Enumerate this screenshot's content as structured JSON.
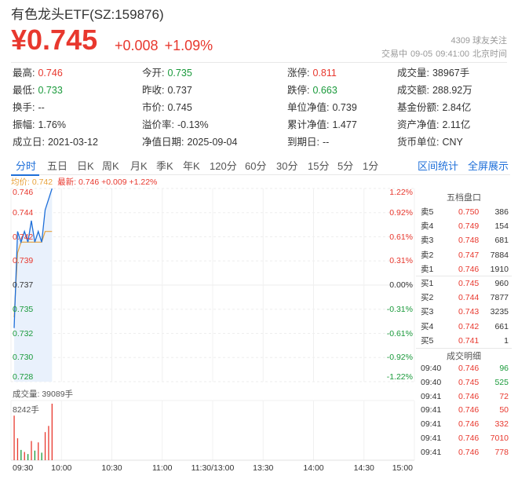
{
  "header": {
    "title": "有色龙头ETF(SZ:159876)",
    "price": "¥0.745",
    "change": "+0.008",
    "change_pct": "+1.09%",
    "followers": "4309 球友关注",
    "status": "交易中",
    "date": "09-05",
    "time": "09:41:00",
    "timezone": "北京时间"
  },
  "stats": [
    {
      "k": "最高:",
      "v": "0.746",
      "color": "red"
    },
    {
      "k": "今开:",
      "v": "0.735",
      "color": "green"
    },
    {
      "k": "涨停:",
      "v": "0.811",
      "color": "red"
    },
    {
      "k": "成交量:",
      "v": "38967手",
      "color": ""
    },
    {
      "k": "最低:",
      "v": "0.733",
      "color": "green"
    },
    {
      "k": "昨收:",
      "v": "0.737",
      "color": ""
    },
    {
      "k": "跌停:",
      "v": "0.663",
      "color": "green"
    },
    {
      "k": "成交额:",
      "v": "288.92万",
      "color": ""
    },
    {
      "k": "换手:",
      "v": "--",
      "color": ""
    },
    {
      "k": "市价:",
      "v": "0.745",
      "color": ""
    },
    {
      "k": "单位净值:",
      "v": "0.739",
      "color": ""
    },
    {
      "k": "基金份额:",
      "v": "2.84亿",
      "color": ""
    },
    {
      "k": "振幅:",
      "v": "1.76%",
      "color": ""
    },
    {
      "k": "溢价率:",
      "v": "-0.13%",
      "color": ""
    },
    {
      "k": "累计净值:",
      "v": "1.477",
      "color": ""
    },
    {
      "k": "资产净值:",
      "v": "2.11亿",
      "color": ""
    },
    {
      "k": "成立日:",
      "v": "2021-03-12",
      "color": ""
    },
    {
      "k": "净值日期:",
      "v": "2025-09-04",
      "color": ""
    },
    {
      "k": "到期日:",
      "v": "--",
      "color": ""
    },
    {
      "k": "货币单位:",
      "v": "CNY",
      "color": ""
    }
  ],
  "tabs": [
    "分时",
    "五日",
    "日K",
    "周K",
    "月K",
    "季K",
    "年K",
    "120分",
    "60分",
    "30分",
    "15分",
    "5分",
    "1分"
  ],
  "tab_active": "分时",
  "tab_links": [
    "区间统计",
    "全屏展示"
  ],
  "legend": {
    "avg": "均价: 0.742",
    "last": "最新: 0.746 +0.009 +1.22%"
  },
  "price_axis": [
    "0.746",
    "0.744",
    "0.742",
    "0.739",
    "0.737",
    "0.735",
    "0.732",
    "0.730",
    "0.728"
  ],
  "pct_axis": [
    "1.22%",
    "0.92%",
    "0.61%",
    "0.31%",
    "0.00%",
    "-0.31%",
    "-0.61%",
    "-0.92%",
    "-1.22%"
  ],
  "time_axis": [
    "09:30",
    "10:00",
    "10:30",
    "11:00",
    "11:30/13:00",
    "13:30",
    "14:00",
    "14:30",
    "15:00"
  ],
  "volume": {
    "label": "成交量: 39089手",
    "max": "8242手"
  },
  "chart_data": {
    "type": "line",
    "x": [
      "09:30",
      "09:31",
      "09:32",
      "09:33",
      "09:34",
      "09:35",
      "09:36",
      "09:37",
      "09:38",
      "09:39",
      "09:40",
      "09:41"
    ],
    "series": [
      {
        "name": "最新",
        "values": [
          0.733,
          0.742,
          0.741,
          0.742,
          0.741,
          0.743,
          0.741,
          0.742,
          0.741,
          0.744,
          0.745,
          0.746
        ]
      },
      {
        "name": "均价",
        "values": [
          0.734,
          0.74,
          0.741,
          0.741,
          0.741,
          0.741,
          0.741,
          0.741,
          0.741,
          0.742,
          0.742,
          0.742
        ]
      }
    ],
    "volume": [
      6500,
      3200,
      1500,
      1200,
      900,
      2800,
      1400,
      2600,
      1100,
      4100,
      5000,
      8242
    ],
    "ylim": [
      0.728,
      0.746
    ],
    "prev_close": 0.737
  },
  "orderbook": {
    "title": "五档盘口",
    "rows": [
      {
        "l": "卖5",
        "p": "0.750",
        "q": "386"
      },
      {
        "l": "卖4",
        "p": "0.749",
        "q": "154"
      },
      {
        "l": "卖3",
        "p": "0.748",
        "q": "681"
      },
      {
        "l": "卖2",
        "p": "0.747",
        "q": "7884"
      },
      {
        "l": "卖1",
        "p": "0.746",
        "q": "1910"
      },
      {
        "l": "买1",
        "p": "0.745",
        "q": "960"
      },
      {
        "l": "买2",
        "p": "0.744",
        "q": "7877"
      },
      {
        "l": "买3",
        "p": "0.743",
        "q": "3235"
      },
      {
        "l": "买4",
        "p": "0.742",
        "q": "661"
      },
      {
        "l": "买5",
        "p": "0.741",
        "q": "1"
      }
    ]
  },
  "trades": {
    "title": "成交明细",
    "rows": [
      {
        "t": "09:40",
        "p": "0.746",
        "q": "96",
        "qc": "green"
      },
      {
        "t": "09:40",
        "p": "0.745",
        "q": "525",
        "qc": "green"
      },
      {
        "t": "09:41",
        "p": "0.746",
        "q": "72",
        "qc": "red"
      },
      {
        "t": "09:41",
        "p": "0.746",
        "q": "50",
        "qc": "red"
      },
      {
        "t": "09:41",
        "p": "0.746",
        "q": "332",
        "qc": "red"
      },
      {
        "t": "09:41",
        "p": "0.746",
        "q": "7010",
        "qc": "red"
      },
      {
        "t": "09:41",
        "p": "0.746",
        "q": "778",
        "qc": "red"
      }
    ]
  },
  "colors": {
    "up": "#e8382e",
    "down": "#1a9a3b",
    "price_line": "#1e6fd9",
    "avg_line": "#e8a23a",
    "accent": "#1e6fd9"
  }
}
